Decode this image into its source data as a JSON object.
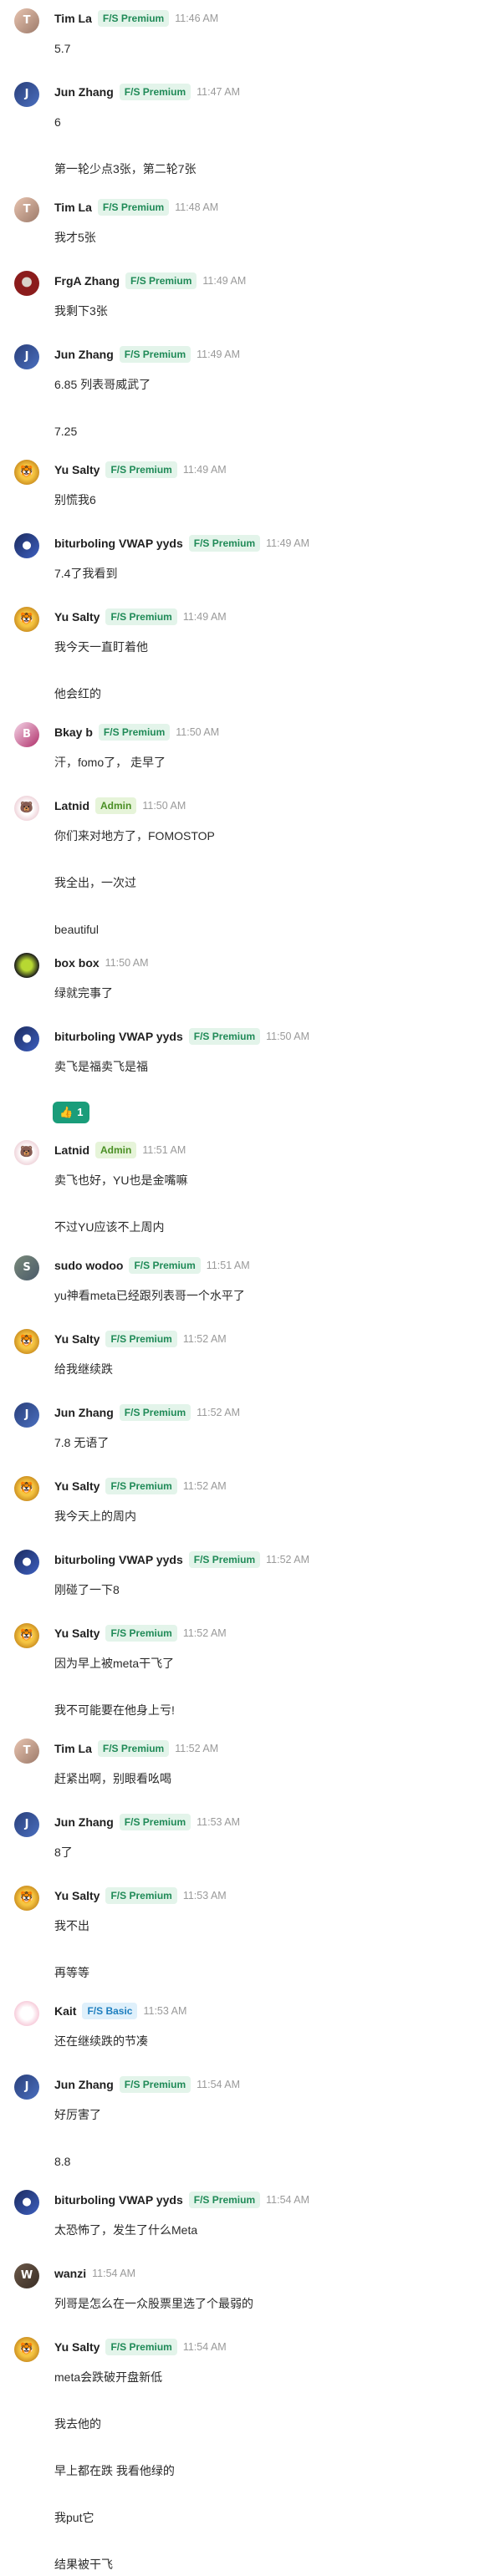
{
  "colors": {
    "premium_bg": "#e3f4ea",
    "premium_fg": "#1f8a57",
    "admin_bg": "#e6f4d9",
    "admin_fg": "#4a8f24",
    "basic_bg": "#dff0fb",
    "basic_fg": "#1f7fbf",
    "reaction": "#1a9d7a"
  },
  "messages": [
    {
      "user": "Tim La",
      "badge": "F/S Premium",
      "badge_type": "premium",
      "time": "11:46 AM",
      "avatar": "tim",
      "lines": [
        "5.7"
      ]
    },
    {
      "user": "Jun Zhang",
      "badge": "F/S Premium",
      "badge_type": "premium",
      "time": "11:47 AM",
      "avatar": "jun",
      "lines": [
        "6",
        "第一轮少点3张，第二轮7张"
      ]
    },
    {
      "user": "Tim La",
      "badge": "F/S Premium",
      "badge_type": "premium",
      "time": "11:48 AM",
      "avatar": "tim",
      "lines": [
        "我才5张"
      ]
    },
    {
      "user": "FrgA Zhang",
      "badge": "F/S Premium",
      "badge_type": "premium",
      "time": "11:49 AM",
      "avatar": "frga",
      "lines": [
        "我剩下3张"
      ]
    },
    {
      "user": "Jun Zhang",
      "badge": "F/S Premium",
      "badge_type": "premium",
      "time": "11:49 AM",
      "avatar": "jun",
      "lines": [
        "6.85 列表哥威武了",
        "7.25"
      ]
    },
    {
      "user": "Yu Salty",
      "badge": "F/S Premium",
      "badge_type": "premium",
      "time": "11:49 AM",
      "avatar": "yu",
      "lines": [
        "别慌我6"
      ]
    },
    {
      "user": "biturboling VWAP yyds",
      "badge": "F/S Premium",
      "badge_type": "premium",
      "time": "11:49 AM",
      "avatar": "bit",
      "lines": [
        "7.4了我看到"
      ]
    },
    {
      "user": "Yu Salty",
      "badge": "F/S Premium",
      "badge_type": "premium",
      "time": "11:49 AM",
      "avatar": "yu",
      "lines": [
        "我今天一直盯着他",
        "他会红的"
      ]
    },
    {
      "user": "Bkay b",
      "badge": "F/S Premium",
      "badge_type": "premium",
      "time": "11:50 AM",
      "avatar": "bkay",
      "lines": [
        "汗，fomo了， 走早了"
      ]
    },
    {
      "user": "Latnid",
      "badge": "Admin",
      "badge_type": "admin",
      "time": "11:50 AM",
      "avatar": "latnid",
      "lines": [
        "你们来对地方了，FOMOSTOP",
        "我全出，一次过",
        "beautiful"
      ]
    },
    {
      "user": "box box",
      "badge": "",
      "badge_type": "none",
      "time": "11:50 AM",
      "avatar": "box",
      "lines": [
        "绿就完事了"
      ]
    },
    {
      "user": "biturboling VWAP yyds",
      "badge": "F/S Premium",
      "badge_type": "premium",
      "time": "11:50 AM",
      "avatar": "bit",
      "lines": [
        "卖飞是福卖飞是福"
      ],
      "reaction": {
        "emoji": "👍",
        "count": "1"
      }
    },
    {
      "user": "Latnid",
      "badge": "Admin",
      "badge_type": "admin",
      "time": "11:51 AM",
      "avatar": "latnid",
      "lines": [
        "卖飞也好，YU也是金嘴嘛",
        "不过YU应该不上周内"
      ]
    },
    {
      "user": "sudo wodoo",
      "badge": "F/S Premium",
      "badge_type": "premium",
      "time": "11:51 AM",
      "avatar": "sudo",
      "lines": [
        "yu神看meta已经跟列表哥一个水平了"
      ]
    },
    {
      "user": "Yu Salty",
      "badge": "F/S Premium",
      "badge_type": "premium",
      "time": "11:52 AM",
      "avatar": "yu",
      "lines": [
        "给我继续跌"
      ]
    },
    {
      "user": "Jun Zhang",
      "badge": "F/S Premium",
      "badge_type": "premium",
      "time": "11:52 AM",
      "avatar": "jun",
      "lines": [
        "7.8 无语了"
      ]
    },
    {
      "user": "Yu Salty",
      "badge": "F/S Premium",
      "badge_type": "premium",
      "time": "11:52 AM",
      "avatar": "yu",
      "lines": [
        "我今天上的周内"
      ]
    },
    {
      "user": "biturboling VWAP yyds",
      "badge": "F/S Premium",
      "badge_type": "premium",
      "time": "11:52 AM",
      "avatar": "bit",
      "lines": [
        "刚碰了一下8"
      ]
    },
    {
      "user": "Yu Salty",
      "badge": "F/S Premium",
      "badge_type": "premium",
      "time": "11:52 AM",
      "avatar": "yu",
      "lines": [
        "因为早上被meta干飞了",
        "我不可能要在他身上亏!"
      ]
    },
    {
      "user": "Tim La",
      "badge": "F/S Premium",
      "badge_type": "premium",
      "time": "11:52 AM",
      "avatar": "tim",
      "lines": [
        "赶紧出啊，别眼看吆喝"
      ]
    },
    {
      "user": "Jun Zhang",
      "badge": "F/S Premium",
      "badge_type": "premium",
      "time": "11:53 AM",
      "avatar": "jun",
      "lines": [
        "8了"
      ]
    },
    {
      "user": "Yu Salty",
      "badge": "F/S Premium",
      "badge_type": "premium",
      "time": "11:53 AM",
      "avatar": "yu",
      "lines": [
        "我不出",
        "再等等"
      ]
    },
    {
      "user": "Kait",
      "badge": "F/S Basic",
      "badge_type": "basic",
      "time": "11:53 AM",
      "avatar": "kait",
      "lines": [
        "还在继续跌的节凑"
      ]
    },
    {
      "user": "Jun Zhang",
      "badge": "F/S Premium",
      "badge_type": "premium",
      "time": "11:54 AM",
      "avatar": "jun",
      "lines": [
        "好厉害了",
        "8.8"
      ]
    },
    {
      "user": "biturboling VWAP yyds",
      "badge": "F/S Premium",
      "badge_type": "premium",
      "time": "11:54 AM",
      "avatar": "bit",
      "lines": [
        "太恐怖了，发生了什么Meta"
      ]
    },
    {
      "user": "wanzi",
      "badge": "",
      "badge_type": "none",
      "time": "11:54 AM",
      "avatar": "wanzi",
      "lines": [
        "列哥是怎么在一众股票里选了个最弱的"
      ]
    },
    {
      "user": "Yu Salty",
      "badge": "F/S Premium",
      "badge_type": "premium",
      "time": "11:54 AM",
      "avatar": "yu",
      "lines": [
        "meta会跌破开盘新低",
        "我去他的",
        "早上都在跌 我看他绿的",
        "我put它",
        "结果被干飞"
      ]
    }
  ]
}
